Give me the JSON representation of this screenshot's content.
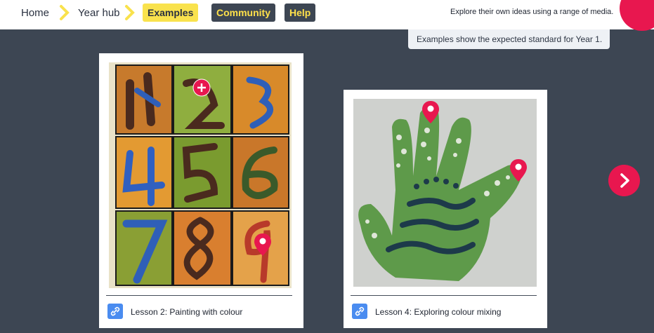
{
  "nav": {
    "home": "Home",
    "year_hub": "Year hub",
    "examples": "Examples",
    "community": "Community",
    "help": "Help",
    "tagline": "Explore their own ideas using a range of media."
  },
  "tooltip": "Examples show the expected standard for Year 1.",
  "cards": [
    {
      "caption": "Lesson 2: Painting with colour",
      "link_icon": "link-icon",
      "markers": [
        "plus-marker",
        "pin-marker"
      ]
    },
    {
      "caption": "Lesson 4: Exploring colour mixing",
      "link_icon": "link-icon",
      "markers": [
        "pin-marker",
        "pin-marker"
      ]
    }
  ],
  "colors": {
    "accent": "#e8174f",
    "highlight": "#f9e24d",
    "background": "#3d4653",
    "link": "#4a8cf0"
  },
  "icons": {
    "breadcrumb_separator": "chevron-right-icon",
    "next": "chevron-right-icon"
  }
}
